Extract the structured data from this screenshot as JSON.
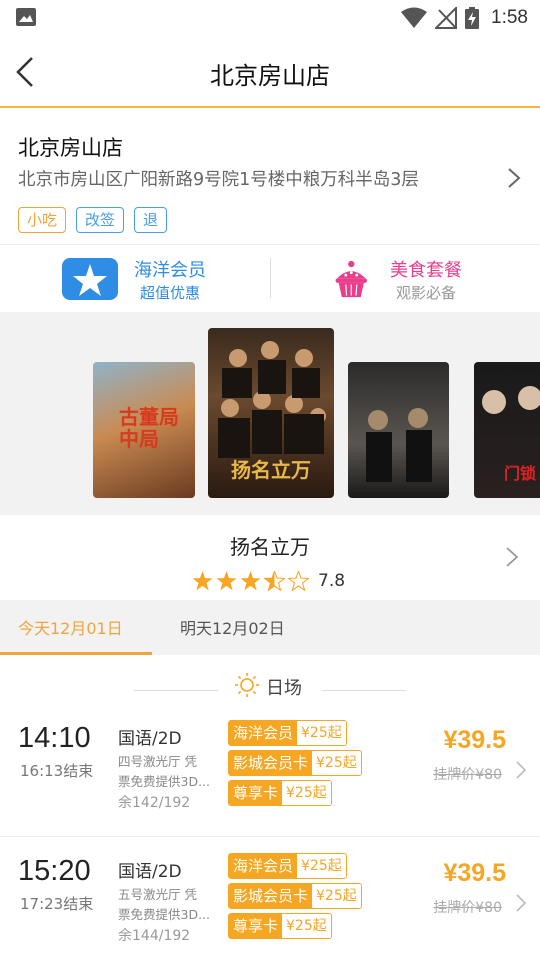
{
  "status_bar": {
    "time": "1:58"
  },
  "header": {
    "title": "北京房山店"
  },
  "cinema": {
    "name": "北京房山店",
    "address": "北京市房山区广阳新路9号院1号楼中粮万科半岛3层",
    "tags": [
      {
        "label": "小吃",
        "color": "#f0a43a"
      },
      {
        "label": "改签",
        "color": "#4a9de8"
      },
      {
        "label": "退",
        "color": "#4a9de8"
      }
    ]
  },
  "promos": [
    {
      "title": "海洋会员",
      "subtitle": "超值优惠",
      "icon": "star-card-icon",
      "color": "#2f8de6"
    },
    {
      "title": "美食套餐",
      "subtitle": "观影必备",
      "icon": "cake-icon",
      "color": "#e83e8c"
    }
  ],
  "posters": [
    {
      "title_art": "古董局中局"
    },
    {
      "title_art": "扬名立万"
    },
    {
      "title_art": ""
    },
    {
      "title_art": "门锁"
    }
  ],
  "movie": {
    "title": "扬名立万",
    "rating": 3.5,
    "score": "7.8"
  },
  "date_tabs": [
    {
      "label": "今天12月01日",
      "active": true
    },
    {
      "label": "明天12月02日",
      "active": false
    }
  ],
  "section": {
    "label": "日场"
  },
  "sessions": [
    {
      "start": "14:10",
      "end": "16:13结束",
      "lang": "国语/2D",
      "hall_line1": "四号激光厅 凭",
      "hall_line2": "票免费提供3D...",
      "seats": "余142/192",
      "cards": [
        {
          "name": "海洋会员",
          "price": "¥25起"
        },
        {
          "name": "影城会员卡",
          "price": "¥25起"
        },
        {
          "name": "尊享卡",
          "price": "¥25起"
        }
      ],
      "price": "¥39.5",
      "list_price": "挂牌价¥80"
    },
    {
      "start": "15:20",
      "end": "17:23结束",
      "lang": "国语/2D",
      "hall_line1": "五号激光厅 凭",
      "hall_line2": "票免费提供3D...",
      "seats": "余144/192",
      "cards": [
        {
          "name": "海洋会员",
          "price": "¥25起"
        },
        {
          "name": "影城会员卡",
          "price": "¥25起"
        },
        {
          "name": "尊享卡",
          "price": "¥25起"
        }
      ],
      "price": "¥39.5",
      "list_price": "挂牌价¥80"
    }
  ]
}
